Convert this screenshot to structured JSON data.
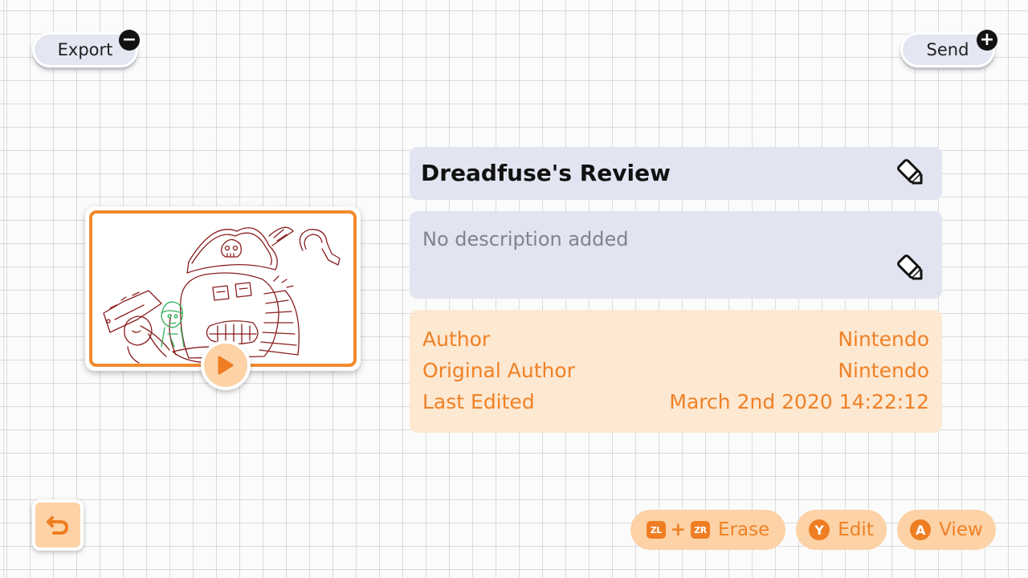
{
  "header": {
    "export_label": "Export",
    "export_badge": "−",
    "send_label": "Send",
    "send_badge": "+"
  },
  "thumbnail": {
    "icons": [
      "drawing-thumbnail",
      "play-icon"
    ]
  },
  "details": {
    "title": "Dreadfuse's Review",
    "description": "No description added",
    "meta": [
      {
        "label": "Author",
        "value": "Nintendo"
      },
      {
        "label": "Original Author",
        "value": "Nintendo"
      },
      {
        "label": "Last Edited",
        "value": "March 2nd 2020 14:22:12"
      }
    ]
  },
  "footer": {
    "back_icon": "back-arrow-icon",
    "erase": {
      "key1": "ZL",
      "plus": "+",
      "key2": "ZR",
      "label": "Erase"
    },
    "edit": {
      "key": "Y",
      "label": "Edit"
    },
    "view": {
      "key": "A",
      "label": "View"
    }
  },
  "colors": {
    "accent_orange": "#ef8126",
    "pill_orange_light": "#fcd2a6",
    "panel_blue": "#e2e5f1",
    "panel_peach": "#fde8d2",
    "sketch_red": "#8a1d1d",
    "sketch_green": "#2fae58"
  }
}
